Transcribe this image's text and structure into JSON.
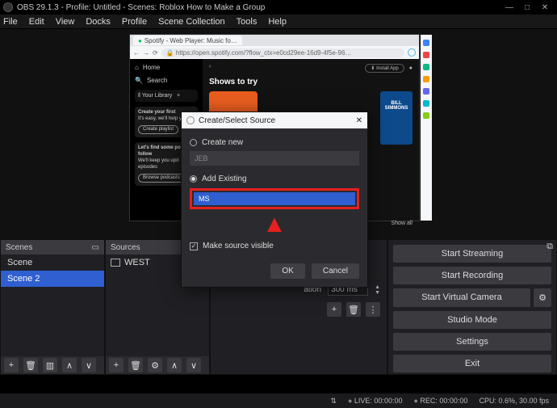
{
  "window": {
    "title": "OBS 29.1.3 - Profile: Untitled - Scenes: Roblox How to Make a Group",
    "minimize": "—",
    "maximize": "□",
    "close": "✕"
  },
  "menu": {
    "file": "File",
    "edit": "Edit",
    "view": "View",
    "docks": "Docks",
    "profile": "Profile",
    "scene_collection": "Scene Collection",
    "tools": "Tools",
    "help": "Help"
  },
  "browser": {
    "tab": "Spotify - Web Player: Music fo…",
    "url": "https://open.spotify.com/?flow_ctx=e0cd29ee-16d9-4f5e-96…",
    "nav": {
      "home": "Home",
      "search": "Search",
      "library": "Your Library"
    },
    "cta1": {
      "title": "Create your first",
      "sub": "It's easy, we'll help y",
      "btn": "Create playlist"
    },
    "cta2": {
      "title": "Let's find some po",
      "sub1": "follow",
      "sub2": "We'll keep you upd",
      "sub3": "episodes",
      "btn": "Browse podcasts"
    },
    "top": {
      "back": "‹",
      "install": "⬇ Install App",
      "user": "●"
    },
    "heading": "Shows to try",
    "bill": "BILL\nSIMMONS",
    "showall": "Show all"
  },
  "modal": {
    "title": "Create/Select Source",
    "close": "✕",
    "create_new": "Create new",
    "name_value": "JEB",
    "add_existing": "Add Existing",
    "existing_item": "MS",
    "visible": "Make source visible",
    "ok": "OK",
    "cancel": "Cancel"
  },
  "scenes": {
    "title": "Scenes",
    "items": [
      "Scene",
      "Scene 2"
    ]
  },
  "sources": {
    "title": "Sources",
    "items": [
      "WEST"
    ]
  },
  "transition": {
    "label": "ation",
    "duration": "300 ms"
  },
  "controls": {
    "start_streaming": "Start Streaming",
    "start_recording": "Start Recording",
    "start_virtual": "Start Virtual Camera",
    "studio": "Studio Mode",
    "settings": "Settings",
    "exit": "Exit"
  },
  "status": {
    "net": "⇅",
    "live": "LIVE: 00:00:00",
    "rec": "REC: 00:00:00",
    "cpu": "CPU: 0.6%, 30.00 fps"
  },
  "icons": {
    "plus": "+",
    "trash": "🗑",
    "filter": "▥",
    "up": "∧",
    "down": "∨",
    "gear": "⚙",
    "dots": "⋮",
    "dock": "⧉"
  }
}
